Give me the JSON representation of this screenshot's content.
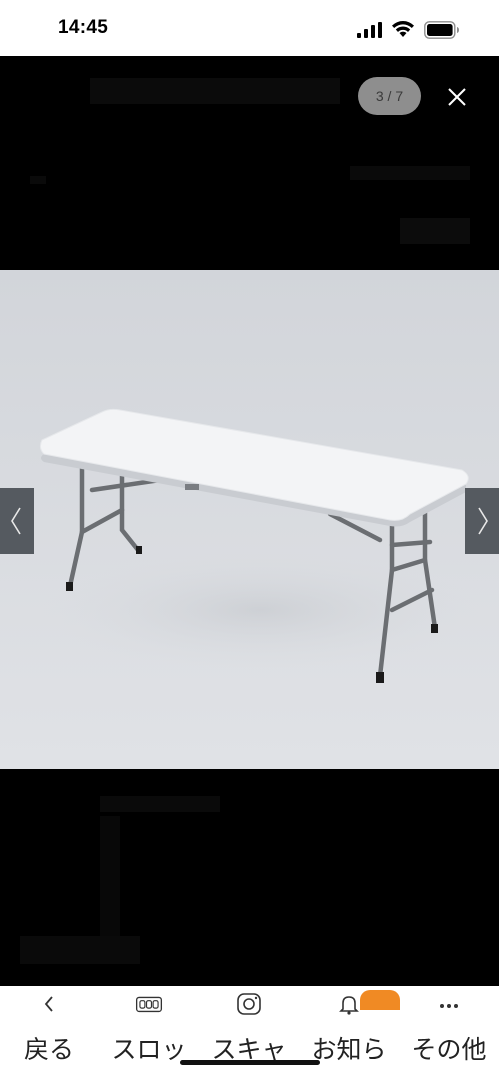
{
  "status_bar": {
    "time": "14:45"
  },
  "viewer": {
    "counter": "3 / 7",
    "image_alt": "white folding table with grey metal legs"
  },
  "bottom_nav": {
    "items": [
      {
        "label": "戻る",
        "icon": "back-icon"
      },
      {
        "label": "スロッ",
        "icon": "slot-icon"
      },
      {
        "label": "スキャ",
        "icon": "camera-icon"
      },
      {
        "label": "お知ら",
        "icon": "bell-icon"
      },
      {
        "label": "その他",
        "icon": "more-icon"
      }
    ]
  },
  "colors": {
    "badge": "#f08a24",
    "backdrop": "#000000",
    "photo_bg": "#d3d6db"
  }
}
